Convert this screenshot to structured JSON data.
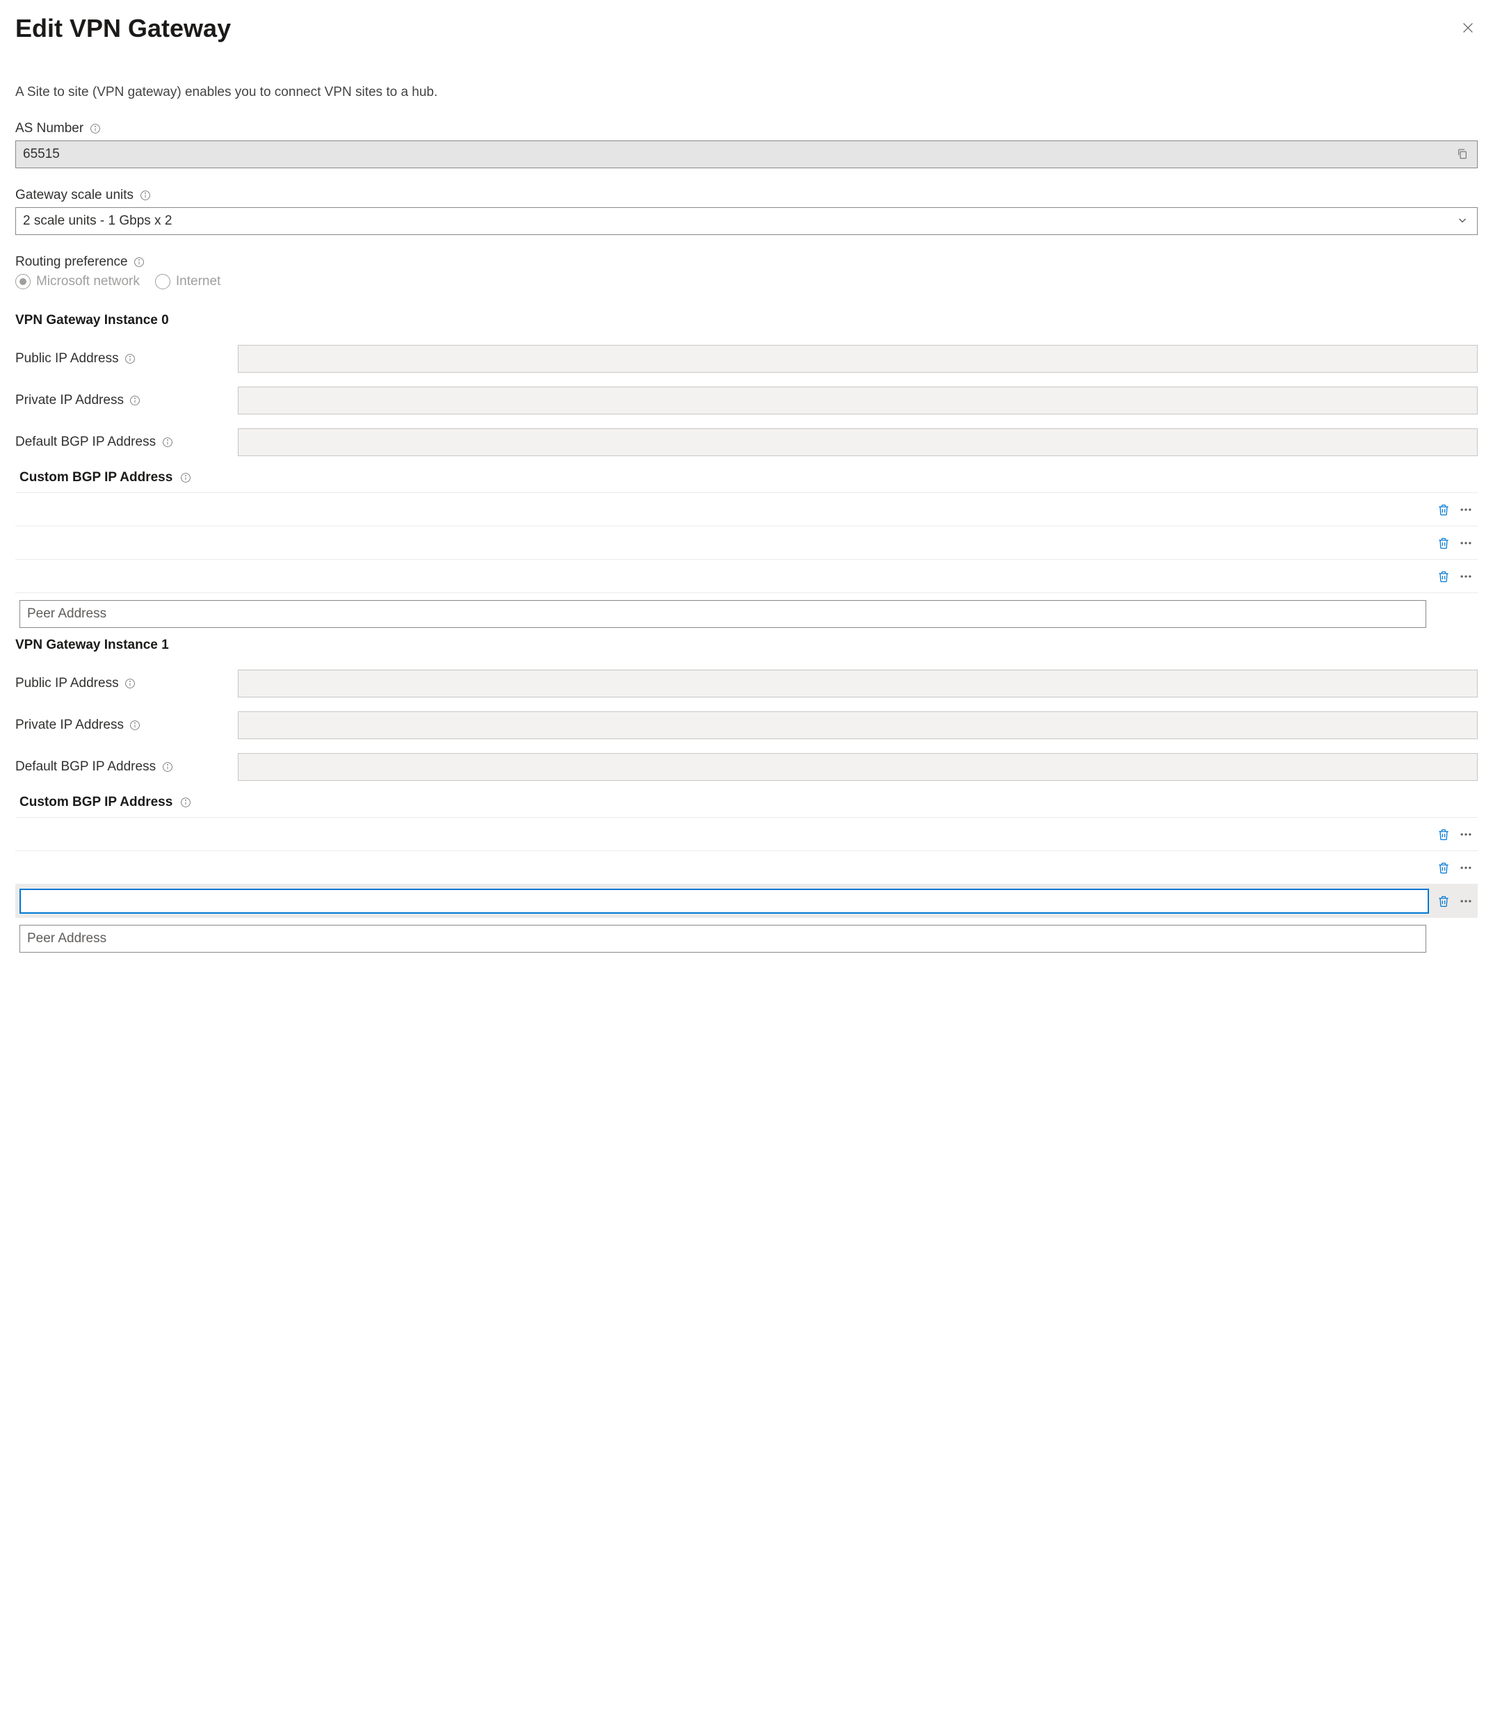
{
  "header": {
    "title": "Edit VPN Gateway"
  },
  "description": "A Site to site (VPN gateway) enables you to connect VPN sites to a hub.",
  "asNumber": {
    "label": "AS Number",
    "value": "65515"
  },
  "gatewayScale": {
    "label": "Gateway scale units",
    "selected": "2 scale units - 1 Gbps x 2"
  },
  "routingPref": {
    "label": "Routing preference",
    "options": {
      "msnet": "Microsoft network",
      "internet": "Internet"
    }
  },
  "instances": [
    {
      "title": "VPN Gateway Instance 0",
      "publicIpLabel": "Public IP Address",
      "privateIpLabel": "Private IP Address",
      "defaultBgpLabel": "Default BGP IP Address",
      "customBgpLabel": "Custom BGP IP Address",
      "peerPlaceholder": "Peer Address"
    },
    {
      "title": "VPN Gateway Instance 1",
      "publicIpLabel": "Public IP Address",
      "privateIpLabel": "Private IP Address",
      "defaultBgpLabel": "Default BGP IP Address",
      "customBgpLabel": "Custom BGP IP Address",
      "peerPlaceholder": "Peer Address"
    }
  ]
}
